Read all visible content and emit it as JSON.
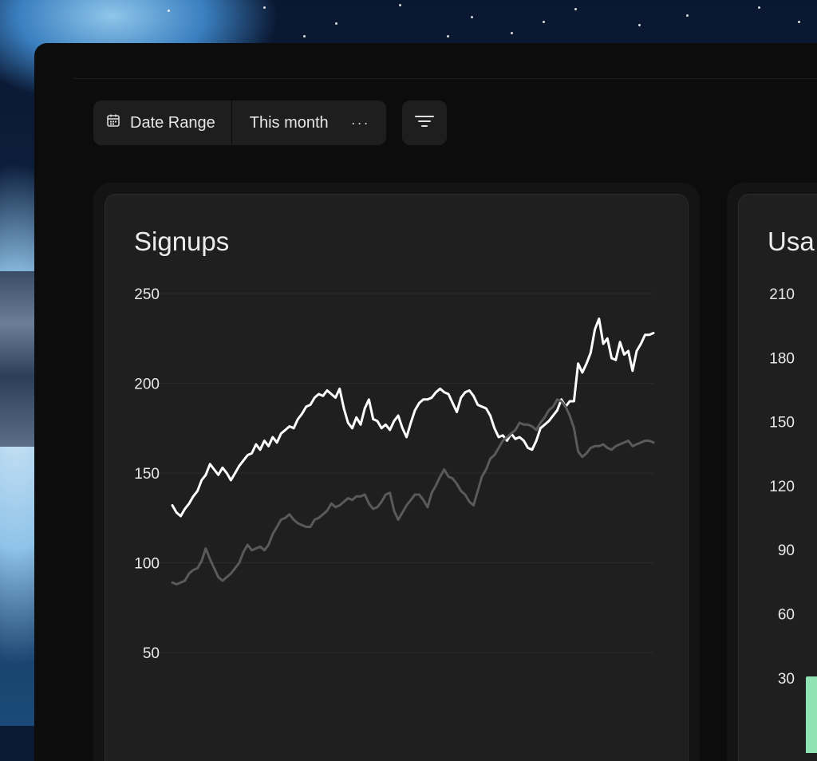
{
  "toolbar": {
    "date_range_label": "Date Range",
    "date_range_value": "This month",
    "more_label": "···"
  },
  "signups_card": {
    "title": "Signups",
    "chart_data": {
      "type": "line",
      "ylim": [
        50,
        250
      ],
      "yticks": [
        250,
        200,
        150,
        100,
        50
      ],
      "series": [
        {
          "color": "#ffffff",
          "values": [
            132,
            128,
            126,
            130,
            133,
            137,
            140,
            146,
            149,
            155,
            152,
            149,
            153,
            150,
            146,
            150,
            154,
            157,
            160,
            161,
            166,
            163,
            168,
            165,
            170,
            167,
            172,
            174,
            176,
            175,
            180,
            183,
            187,
            188,
            192,
            194,
            193,
            196,
            194,
            192,
            197,
            186,
            178,
            175,
            181,
            177,
            186,
            191,
            180,
            179,
            175,
            177,
            174,
            179,
            182,
            175,
            170,
            178,
            185,
            189,
            191,
            191,
            192,
            195,
            197,
            195,
            194,
            189,
            184,
            192,
            195,
            196,
            193,
            188,
            187,
            186,
            182,
            175,
            170,
            171,
            168,
            172,
            169,
            170,
            168,
            164,
            163,
            168,
            175,
            177,
            179,
            182,
            185,
            191,
            187,
            190,
            190,
            211,
            206,
            211,
            217,
            230,
            236,
            222,
            225,
            214,
            213,
            223,
            216,
            218,
            207,
            218,
            222,
            227,
            227,
            228
          ]
        },
        {
          "color": "#5a5a5a",
          "values": [
            89,
            88,
            89,
            90,
            94,
            96,
            97,
            101,
            108,
            102,
            97,
            92,
            90,
            92,
            94,
            97,
            100,
            106,
            110,
            107,
            108,
            109,
            107,
            110,
            116,
            120,
            124,
            125,
            127,
            124,
            122,
            121,
            120,
            120,
            124,
            125,
            127,
            129,
            133,
            131,
            132,
            134,
            136,
            135,
            137,
            137,
            138,
            133,
            130,
            131,
            134,
            138,
            139,
            129,
            124,
            128,
            132,
            135,
            138,
            138,
            135,
            131,
            139,
            143,
            148,
            152,
            148,
            147,
            144,
            140,
            138,
            134,
            132,
            140,
            148,
            152,
            158,
            160,
            164,
            168,
            170,
            172,
            174,
            178,
            177,
            177,
            176,
            174,
            178,
            181,
            185,
            187,
            191,
            190,
            187,
            182,
            175,
            162,
            159,
            161,
            164,
            165,
            165,
            166,
            164,
            163,
            165,
            166,
            167,
            168,
            165,
            166,
            167,
            168,
            168,
            167
          ]
        }
      ]
    }
  },
  "usage_card": {
    "title": "Usa",
    "chart_data": {
      "type": "bar",
      "yticks": [
        210,
        180,
        150,
        120,
        90,
        60,
        30
      ],
      "bar_color": "#8fe3b5"
    }
  }
}
